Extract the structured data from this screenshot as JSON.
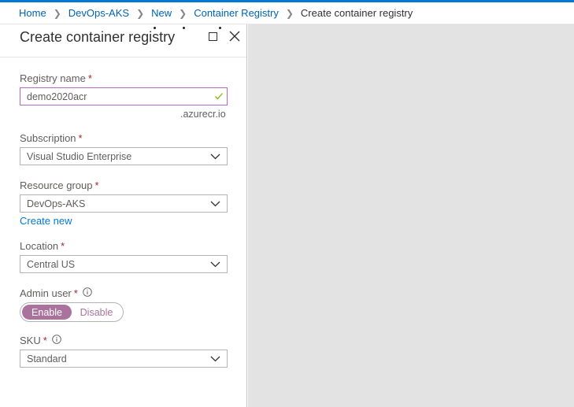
{
  "breadcrumb": {
    "items": [
      "Home",
      "DevOps-AKS",
      "New",
      "Container Registry"
    ],
    "current": "Create container registry"
  },
  "blade": {
    "title": "Create container registry"
  },
  "form": {
    "registry_name": {
      "label": "Registry name",
      "required": "*",
      "value": "demo2020acr",
      "suffix": ".azurecr.io"
    },
    "subscription": {
      "label": "Subscription",
      "required": "*",
      "value": "Visual Studio Enterprise"
    },
    "resource_group": {
      "label": "Resource group",
      "required": "*",
      "value": "DevOps-AKS",
      "create_new": "Create new"
    },
    "location": {
      "label": "Location",
      "required": "*",
      "value": "Central US"
    },
    "admin_user": {
      "label": "Admin user",
      "required": "*",
      "options": [
        "Enable",
        "Disable"
      ],
      "selected": "Enable"
    },
    "sku": {
      "label": "SKU",
      "required": "*",
      "value": "Standard"
    }
  },
  "colors": {
    "accent": "#0078d4",
    "link": "#0063b1",
    "required": "#a4262c",
    "toggle_on": "#a9739e",
    "valid_check": "#7fba00",
    "active_border": "#b469c4"
  },
  "icons": [
    "chevron-right-icon",
    "maximize-icon",
    "close-icon",
    "checkmark-icon",
    "chevron-down-icon",
    "info-icon"
  ]
}
